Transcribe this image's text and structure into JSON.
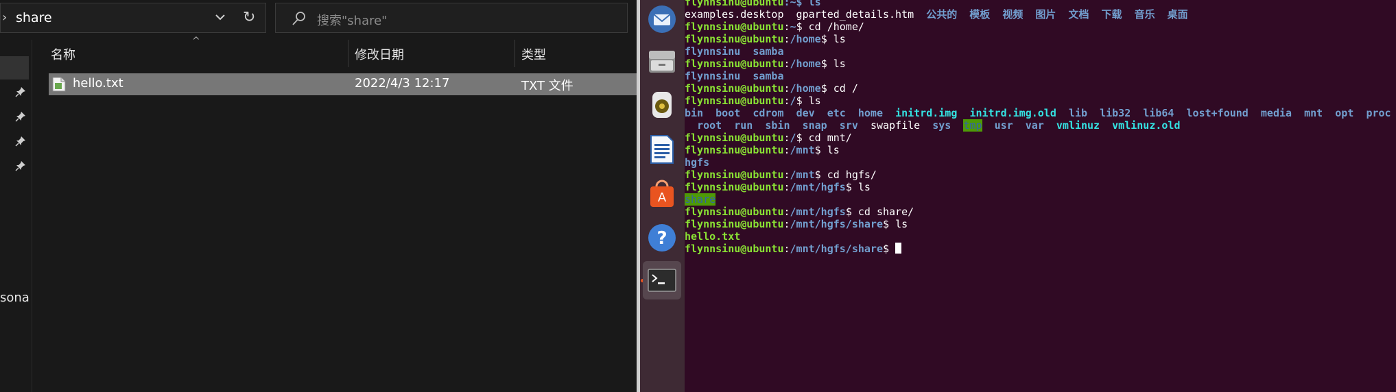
{
  "explorer": {
    "address_path": "share",
    "search_placeholder": "搜索\"share\"",
    "nav_partial_label": "sona",
    "columns": {
      "name": "名称",
      "modified": "修改日期",
      "type": "类型"
    },
    "files": [
      {
        "name": "hello.txt",
        "modified": "2022/4/3 12:17",
        "type": "TXT 文件"
      }
    ]
  },
  "launcher": {
    "apps": [
      "thunderbird-icon",
      "files-icon",
      "rhythmbox-icon",
      "libreoffice-writer-icon",
      "software-center-icon",
      "help-icon",
      "terminal-icon"
    ]
  },
  "terminal": {
    "user": "flynnsinu@ubuntu",
    "lines": {
      "l0_tail": ":~$ ls",
      "l1_a": "examples.desktop  gparted_details.htm  ",
      "l1_b": "公共的  模板  视频  图片  文档  下载  音乐  桌面",
      "l2_path": "~",
      "l2_cmd": "cd /home/",
      "l3_path": "/home",
      "l3_cmd": "ls",
      "l4_out": "flynnsinu  samba",
      "l5_path": "/home",
      "l5_cmd": "ls",
      "l6_out": "flynnsinu  samba",
      "l7_path": "/home",
      "l7_cmd": "cd /",
      "l8_path": "/",
      "l8_cmd": "ls",
      "ls_root_1": [
        "bin",
        "boot",
        "cdrom",
        "dev",
        "etc",
        "home"
      ],
      "ls_root_links": [
        "initrd.img",
        "initrd.img.old"
      ],
      "ls_root_2": [
        "lib",
        "lib32",
        "lib64",
        "lost+found",
        "media",
        "mnt",
        "opt",
        "proc"
      ],
      "ls_root_3": [
        "root",
        "run",
        "sbin",
        "snap",
        "srv"
      ],
      "ls_root_swap": "swapfile",
      "ls_root_sys": "sys",
      "ls_root_tmp": "tmp",
      "ls_root_4": [
        "usr",
        "var"
      ],
      "ls_root_links2": [
        "vmlinuz",
        "vmlinuz.old"
      ],
      "l11_path": "/",
      "l11_cmd": "cd mnt/",
      "l12_path": "/mnt",
      "l12_cmd": "ls",
      "l13_out": "hgfs",
      "l14_path": "/mnt",
      "l14_cmd": "cd hgfs/",
      "l15_path": "/mnt/hgfs",
      "l15_cmd": "ls",
      "l16_out": "share",
      "l17_path": "/mnt/hgfs",
      "l17_cmd": "cd share/",
      "l18_path": "/mnt/hgfs/share",
      "l18_cmd": "ls",
      "l19_out": "hello.txt",
      "l20_path": "/mnt/hgfs/share",
      "l20_cmd": ""
    }
  },
  "colors": {
    "terminal_bg": "#300a24",
    "prompt_user": "#8ae234",
    "prompt_path": "#729fcf",
    "symlink": "#34e2e2",
    "launcher_bg": "#3e2a34",
    "explorer_bg": "#191919",
    "selected_row": "#777777"
  }
}
